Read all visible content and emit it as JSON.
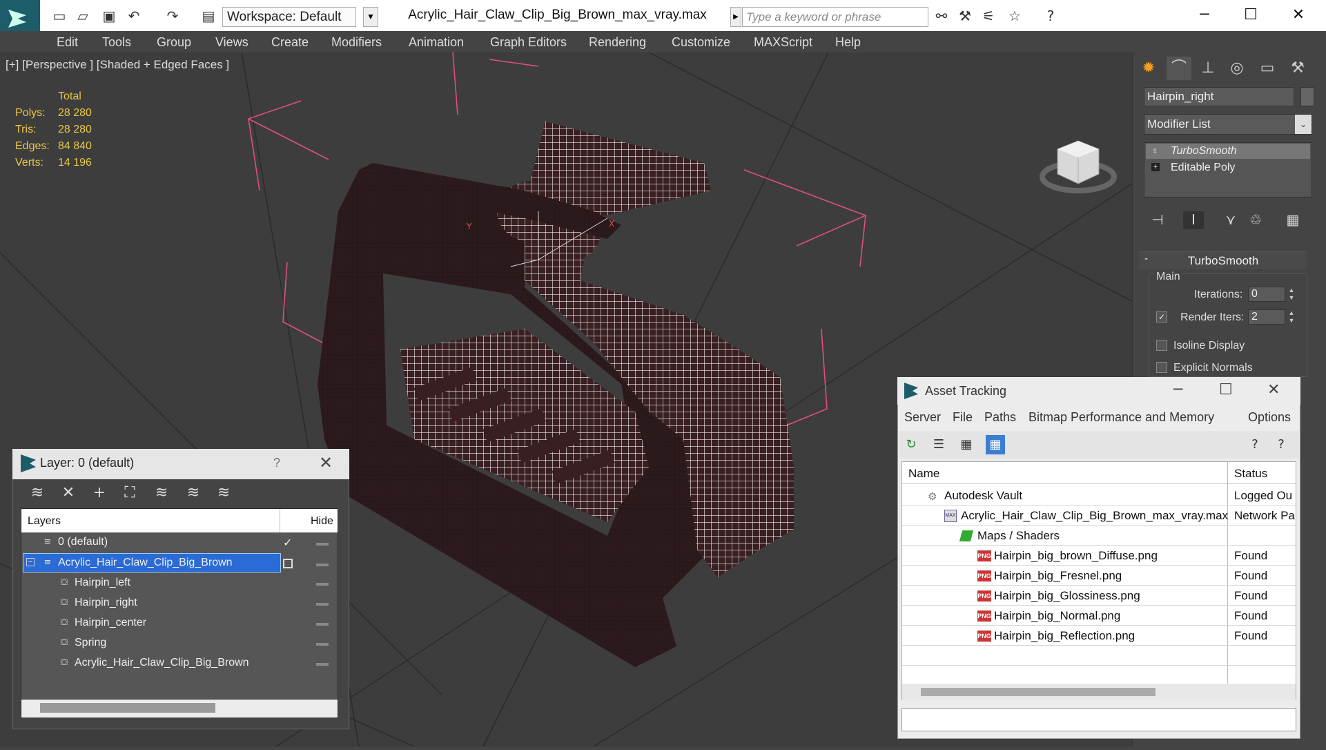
{
  "titlebar": {
    "workspace": "Workspace: Default",
    "title": "Acrylic_Hair_Claw_Clip_Big_Brown_max_vray.max",
    "search_placeholder": "Type a keyword or phrase"
  },
  "menu": [
    "Edit",
    "Tools",
    "Group",
    "Views",
    "Create",
    "Modifiers",
    "Animation",
    "Graph Editors",
    "Rendering",
    "Customize",
    "MAXScript",
    "Help"
  ],
  "viewport": {
    "label": "[+] [Perspective ] [Shaded + Edged Faces ]",
    "stats_header": "Total",
    "stats": [
      {
        "label": "Polys:",
        "value": "28 280"
      },
      {
        "label": "Tris:",
        "value": "28 280"
      },
      {
        "label": "Edges:",
        "value": "84 840"
      },
      {
        "label": "Verts:",
        "value": "14 196"
      }
    ]
  },
  "command_panel": {
    "object_name": "Hairpin_right",
    "modifier_list": "Modifier List",
    "stack": [
      "TurboSmooth",
      "Editable Poly"
    ],
    "rollout_title": "TurboSmooth",
    "group_label": "Main",
    "iterations_label": "Iterations:",
    "iterations_value": "0",
    "render_iters_label": "Render Iters:",
    "render_iters_value": "2",
    "render_iters_checked": true,
    "isoline_label": "Isoline Display",
    "explicit_label": "Explicit Normals"
  },
  "layer_dialog": {
    "title": "Layer: 0 (default)",
    "help": "?",
    "col_layers": "Layers",
    "col_hide": "Hide",
    "rows": [
      {
        "name": "0 (default)",
        "indent": 0,
        "active": true,
        "selected": false
      },
      {
        "name": "Acrylic_Hair_Claw_Clip_Big_Brown",
        "indent": 0,
        "active": false,
        "selected": true
      },
      {
        "name": "Hairpin_left",
        "indent": 1
      },
      {
        "name": "Hairpin_right",
        "indent": 1
      },
      {
        "name": "Hairpin_center",
        "indent": 1
      },
      {
        "name": "Spring",
        "indent": 1
      },
      {
        "name": "Acrylic_Hair_Claw_Clip_Big_Brown",
        "indent": 1
      }
    ]
  },
  "asset_dialog": {
    "title": "Asset Tracking",
    "menus": [
      "Server",
      "File",
      "Paths",
      "Bitmap Performance and Memory",
      "Options"
    ],
    "col_name": "Name",
    "col_status": "Status",
    "rows": [
      {
        "name": "Autodesk Vault",
        "status": "Logged Ou",
        "indent": 0,
        "icon": "vault-icon"
      },
      {
        "name": "Acrylic_Hair_Claw_Clip_Big_Brown_max_vray.max",
        "status": "Network Pa",
        "indent": 1,
        "icon": "max-file-icon"
      },
      {
        "name": "Maps / Shaders",
        "status": "",
        "indent": 2,
        "icon": "maps-icon"
      },
      {
        "name": "Hairpin_big_brown_Diffuse.png",
        "status": "Found",
        "indent": 3,
        "icon": "png-icon"
      },
      {
        "name": "Hairpin_big_Fresnel.png",
        "status": "Found",
        "indent": 3,
        "icon": "png-icon"
      },
      {
        "name": "Hairpin_big_Glossiness.png",
        "status": "Found",
        "indent": 3,
        "icon": "png-icon"
      },
      {
        "name": "Hairpin_big_Normal.png",
        "status": "Found",
        "indent": 3,
        "icon": "png-icon"
      },
      {
        "name": "Hairpin_big_Reflection.png",
        "status": "Found",
        "indent": 3,
        "icon": "png-icon"
      }
    ]
  },
  "colors": {
    "accent": "#1d5d6a",
    "stats": "#e8c846",
    "selection": "#2a6bd6",
    "bbox": "#e0507a"
  }
}
